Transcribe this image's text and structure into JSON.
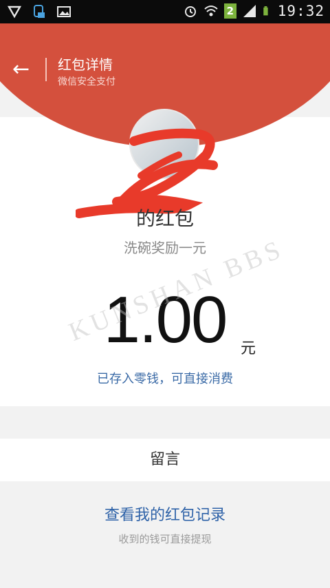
{
  "status_bar": {
    "time": "19:32",
    "sim_badge": "2",
    "icons": [
      "shield-icon",
      "notification-icon",
      "image-icon",
      "alarm-icon",
      "wifi-icon",
      "signal-icon",
      "battery-icon"
    ]
  },
  "header": {
    "title": "红包详情",
    "subtitle": "微信安全支付",
    "back_icon": "back-arrow-icon",
    "bg_color": "#d4503d"
  },
  "packet": {
    "sender": "的红包",
    "remark": "洗碗奖励一元",
    "amount": "1.00",
    "unit": "元",
    "note": "已存入零钱，可直接消费"
  },
  "messages": {
    "label": "留言"
  },
  "records": {
    "link": "查看我的红包记录",
    "note": "收到的钱可直接提现"
  },
  "watermark": "KUNSHAN BBS"
}
